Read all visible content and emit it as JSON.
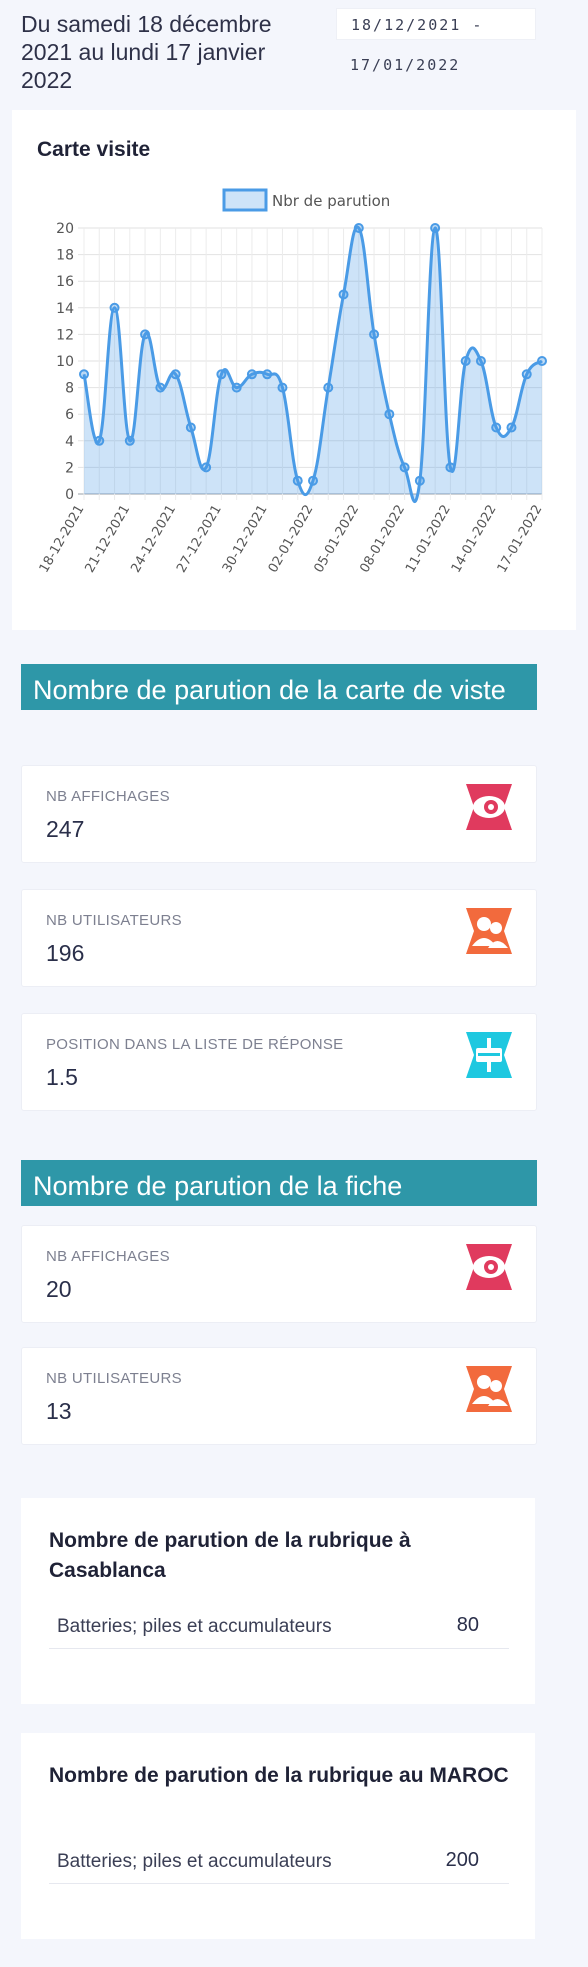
{
  "date_range": {
    "text": "Du samedi 18 décembre 2021 au lundi 17 janvier 2022",
    "input_line1": "18/12/2021 -",
    "input_line2": "17/01/2022"
  },
  "chart_card": {
    "title": "Carte visite"
  },
  "chart_data": {
    "type": "line",
    "title": "Carte visite",
    "legend": [
      "Nbr de parution"
    ],
    "legend_position": "top",
    "x": [
      "18-12-2021",
      "19-12-2021",
      "20-12-2021",
      "21-12-2021",
      "22-12-2021",
      "23-12-2021",
      "24-12-2021",
      "25-12-2021",
      "26-12-2021",
      "27-12-2021",
      "28-12-2021",
      "29-12-2021",
      "30-12-2021",
      "31-12-2021",
      "01-01-2022",
      "02-01-2022",
      "03-01-2022",
      "04-01-2022",
      "05-01-2022",
      "06-01-2022",
      "07-01-2022",
      "08-01-2022",
      "09-01-2022",
      "10-01-2022",
      "11-01-2022",
      "12-01-2022",
      "13-01-2022",
      "14-01-2022",
      "15-01-2022",
      "16-01-2022",
      "17-01-2022"
    ],
    "x_tick_labels": [
      "18-12-2021",
      "21-12-2021",
      "24-12-2021",
      "27-12-2021",
      "30-12-2021",
      "02-01-2022",
      "05-01-2022",
      "08-01-2022",
      "11-01-2022",
      "14-01-2022",
      "17-01-2022"
    ],
    "series": [
      {
        "name": "Nbr de parution",
        "values": [
          9,
          4,
          14,
          4,
          12,
          8,
          9,
          5,
          2,
          9,
          8,
          9,
          9,
          8,
          1,
          1,
          8,
          15,
          20,
          12,
          6,
          2,
          1,
          20,
          2,
          10,
          10,
          5,
          5,
          9,
          10
        ],
        "color": "#4a9be6"
      }
    ],
    "ylim": [
      0,
      20
    ],
    "y_ticks": [
      0,
      2,
      4,
      6,
      8,
      10,
      12,
      14,
      16,
      18,
      20
    ],
    "grid": true
  },
  "section_carte": {
    "title": "Nombre de parution de la carte de viste",
    "stats": [
      {
        "label": "NB AFFICHAGES",
        "value": "247",
        "icon": "eye-icon",
        "color": "#e03a5e"
      },
      {
        "label": "NB UTILISATEURS",
        "value": "196",
        "icon": "users-icon",
        "color": "#f26a3d"
      },
      {
        "label": "POSITION DANS LA LISTE DE RÉPONSE",
        "value": "1.5",
        "icon": "position-icon",
        "color": "#1ec8e0"
      }
    ]
  },
  "section_fiche": {
    "title": "Nombre de parution de la fiche",
    "stats": [
      {
        "label": "NB AFFICHAGES",
        "value": "20",
        "icon": "eye-icon",
        "color": "#e03a5e"
      },
      {
        "label": "NB UTILISATEURS",
        "value": "13",
        "icon": "users-icon",
        "color": "#f26a3d"
      }
    ]
  },
  "rubrique_casablanca": {
    "title": "Nombre de parution de la rubrique à Casablanca",
    "rows": [
      {
        "label": "Batteries; piles et accumulateurs",
        "value": "80"
      }
    ]
  },
  "rubrique_maroc": {
    "title": "Nombre de parution de la rubrique au MAROC",
    "rows": [
      {
        "label": "Batteries; piles et accumulateurs",
        "value": "200"
      }
    ]
  }
}
